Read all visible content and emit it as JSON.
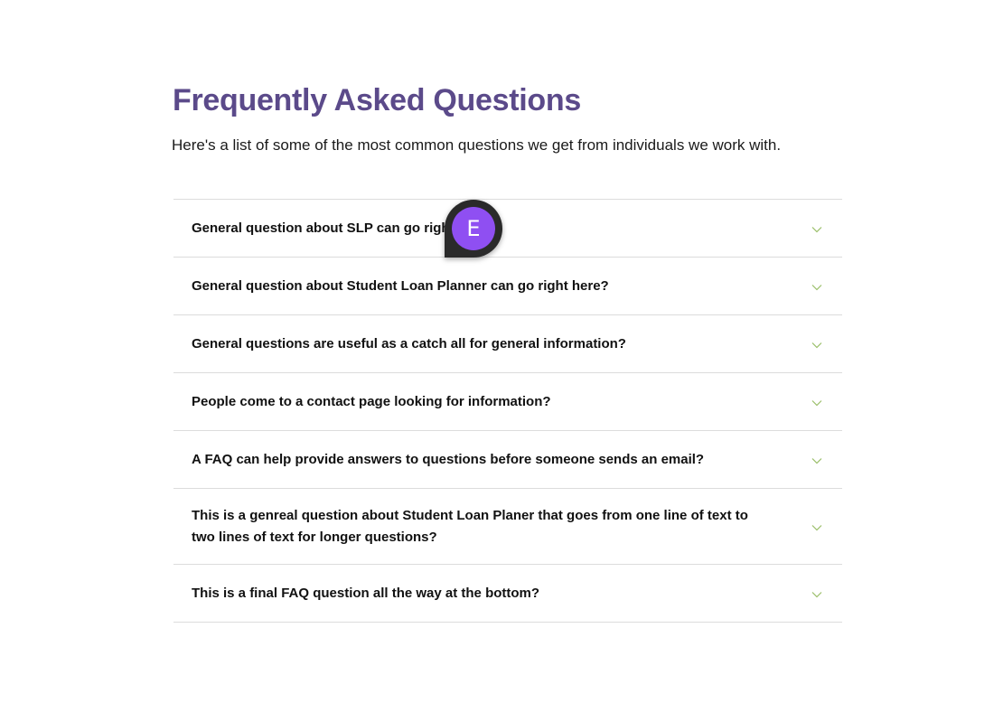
{
  "faq": {
    "title": "Frequently Asked Questions",
    "subtitle": "Here's a list of some of the most common questions we get from individuals we work with.",
    "items": [
      {
        "question": "General question about SLP can go right here?",
        "icon": "chevron-down-icon"
      },
      {
        "question": "General question about Student Loan Planner can go right here?",
        "icon": "chevron-down-icon"
      },
      {
        "question": "General questions are useful as a catch all for general information?",
        "icon": "chevron-down-icon"
      },
      {
        "question": "People come to a contact page looking for information?",
        "icon": "chevron-down-icon"
      },
      {
        "question": "A FAQ can help provide answers to questions before someone sends an email?",
        "icon": "chevron-down-icon"
      },
      {
        "question": "This is a genreal question about Student Loan Planer that goes from one line of text to two lines of text for longer questions?",
        "icon": "chevron-down-icon"
      },
      {
        "question": "This is a final FAQ question all the way at the bottom?",
        "icon": "chevron-down-icon"
      }
    ]
  },
  "avatar": {
    "initial": "E",
    "color": "#8f4ff2"
  },
  "colors": {
    "title": "#5b4a8a",
    "chevron": "#9bbf6a",
    "divider": "#dcdcdc"
  }
}
